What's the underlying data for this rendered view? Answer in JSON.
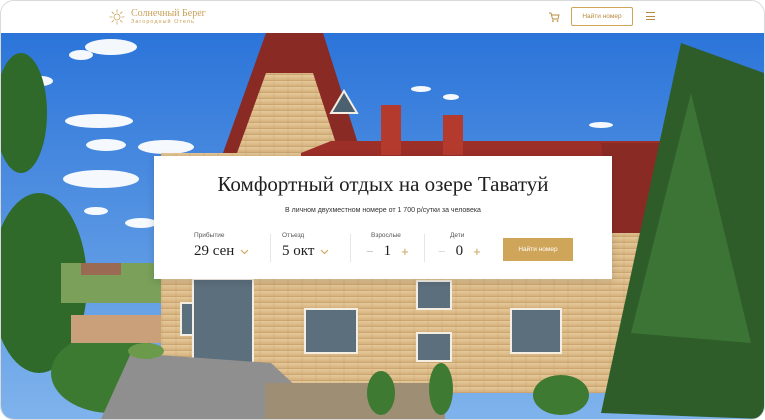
{
  "brand": {
    "name": "Солнечный Берег",
    "tagline": "Загородный Отель",
    "accent": "#cfa55a"
  },
  "header": {
    "find_room_label": "Найти номер",
    "cart_icon": "cart-icon",
    "menu_icon": "hamburger-icon"
  },
  "hero": {
    "headline": "Комфортный отдых на озере Таватуй",
    "subline": "В личном двухместном номере от 1 700 р/сутки за человека"
  },
  "booking": {
    "arrival": {
      "label": "Прибытие",
      "value": "29 сен"
    },
    "departure": {
      "label": "Отъезд",
      "value": "5 окт"
    },
    "adults": {
      "label": "Взрослые",
      "value": "1",
      "minus": "−",
      "plus": "+"
    },
    "children": {
      "label": "Дети",
      "value": "0",
      "minus": "−",
      "plus": "+"
    },
    "submit_label": "Найти номер"
  }
}
